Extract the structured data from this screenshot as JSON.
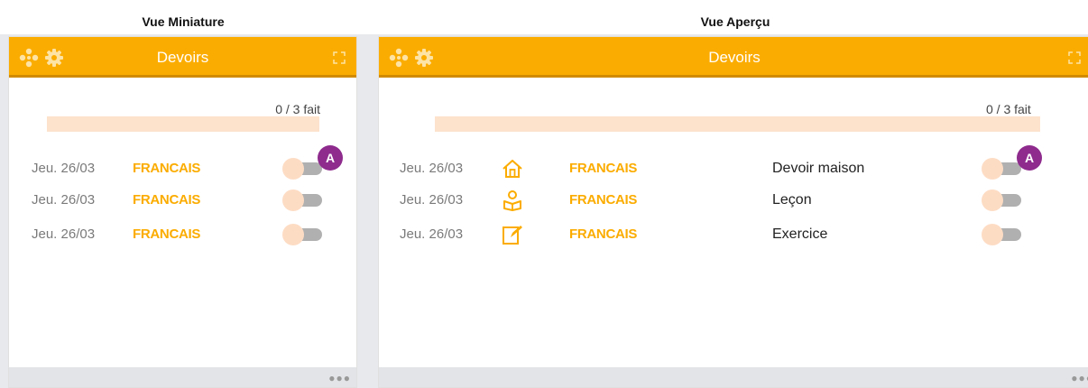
{
  "views": {
    "miniature_title": "Vue Miniature",
    "apercu_title": "Vue Aperçu"
  },
  "widget": {
    "title": "Devoirs",
    "progress_text": "0 / 3 fait",
    "progress": {
      "done": 0,
      "total": 3
    },
    "avatar_letter": "A"
  },
  "homework": [
    {
      "date": "Jeu. 26/03",
      "subject": "FRANCAIS",
      "type": "Devoir maison",
      "icon": "house-icon",
      "done": false
    },
    {
      "date": "Jeu. 26/03",
      "subject": "FRANCAIS",
      "type": "Leçon",
      "icon": "student-reading-icon",
      "done": false
    },
    {
      "date": "Jeu. 26/03",
      "subject": "FRANCAIS",
      "type": "Exercice",
      "icon": "edit-sheet-icon",
      "done": false
    }
  ],
  "colors": {
    "accent": "#fbac00",
    "progress_bg": "#fde2cc",
    "avatar": "#8e2b8d"
  }
}
